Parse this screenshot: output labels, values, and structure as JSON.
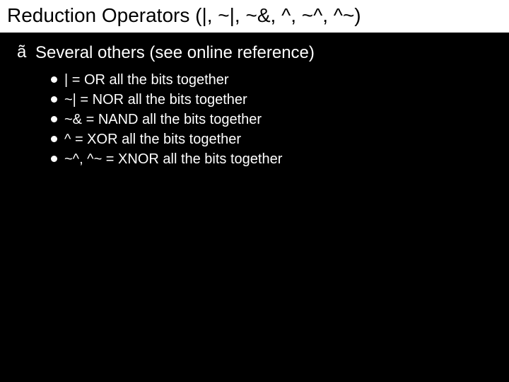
{
  "title": "Reduction Operators (|, ~|, ~&, ^, ~^, ^~)",
  "topMarker": "ã",
  "heading": "Several others (see online reference)",
  "items": [
    "|  = OR all the bits together",
    "~|  = NOR all the bits together",
    "~&  = NAND all the bits together",
    "^  = XOR all the bits together",
    "~^, ^~  = XNOR all the bits together"
  ]
}
